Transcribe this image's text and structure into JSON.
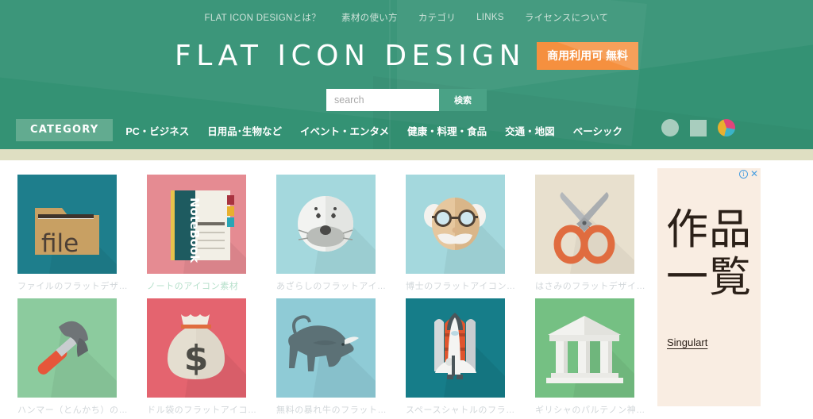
{
  "header": {
    "top_nav": [
      "FLAT ICON DESIGNとは？",
      "素材の使い方",
      "カテゴリ",
      "LINKS",
      "ライセンスについて"
    ],
    "logo": "FLAT ICON DESIGN",
    "badge": "商用利用可 無料",
    "bg_color": "#349274",
    "badge_color": "#f5903f"
  },
  "search": {
    "placeholder": "search",
    "value": "",
    "button_label": "検索"
  },
  "category_bar": {
    "pill_label": "CATEGORY",
    "links": [
      "PC・ビジネス",
      "日用品･生物など",
      "イベント・エンタメ",
      "健康・料理・食品",
      "交通・地図",
      "ベーシック"
    ],
    "shape_buttons": [
      {
        "name": "circle-shape-button",
        "color": "#a8cdbe"
      },
      {
        "name": "square-shape-button",
        "color": "#a8cdbe"
      },
      {
        "name": "pie-shape-button",
        "colors": [
          "#e0457b",
          "#3bb3c9",
          "#e8b02e"
        ]
      }
    ]
  },
  "cards": [
    {
      "label": "ファイルのフラットデザ…",
      "icon": "file-folder-icon",
      "bg": "#1e7e8c",
      "highlighted": false
    },
    {
      "label": "ノートのアイコン素材",
      "icon": "notebook-icon",
      "bg": "#e58b92",
      "highlighted": true
    },
    {
      "label": "あざらしのフラットアイ…",
      "icon": "seal-face-icon",
      "bg": "#a4d8dd",
      "highlighted": false
    },
    {
      "label": "博士のフラットアイコン…",
      "icon": "professor-face-icon",
      "bg": "#a4d8dd",
      "highlighted": false
    },
    {
      "label": "はさみのフラットデザイ…",
      "icon": "scissors-icon",
      "bg": "#e8e0ce",
      "highlighted": false
    },
    {
      "label": "ハンマー（とんかち）の…",
      "icon": "hammer-icon",
      "bg": "#8ccb9e",
      "highlighted": false
    },
    {
      "label": "ドル袋のフラットアイコ…",
      "icon": "money-bag-icon",
      "bg": "#e4646f",
      "highlighted": false
    },
    {
      "label": "無料の暴れ牛のフラット…",
      "icon": "bull-icon",
      "bg": "#8fcbd6",
      "highlighted": false
    },
    {
      "label": "スペースシャトルのフラ…",
      "icon": "space-shuttle-icon",
      "bg": "#167d89",
      "highlighted": false
    },
    {
      "label": "ギリシャのパルテノン神…",
      "icon": "parthenon-temple-icon",
      "bg": "#75c083",
      "highlighted": false
    }
  ],
  "ad": {
    "headline": "作品一覧",
    "brand": "Singulart",
    "bg_text": "Singulart",
    "bg_color": "#f9ede2",
    "info_icon": "ⓘ",
    "close_icon": "✕"
  }
}
